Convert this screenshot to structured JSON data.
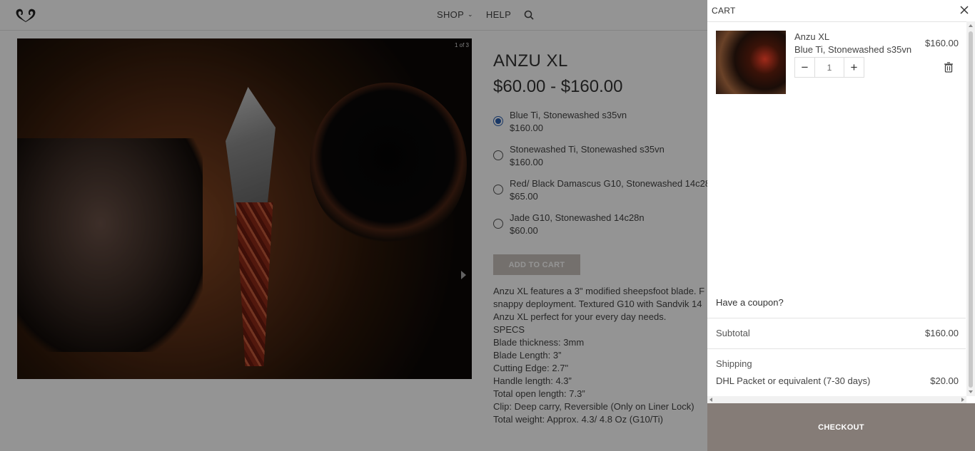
{
  "header": {
    "nav": [
      {
        "label": "SHOP",
        "has_dropdown": true
      },
      {
        "label": "HELP",
        "has_dropdown": false
      }
    ]
  },
  "gallery": {
    "counter": "1 of 3"
  },
  "product": {
    "title": "ANZU XL",
    "price_range": "$60.00 - $160.00",
    "variants": [
      {
        "name": "Blue Ti, Stonewashed s35vn",
        "price": "$160.00",
        "selected": true
      },
      {
        "name": "Stonewashed Ti, Stonewashed s35vn",
        "price": "$160.00",
        "selected": false
      },
      {
        "name": "Red/ Black Damascus G10, Stonewashed 14c28",
        "price": "$65.00",
        "selected": false
      },
      {
        "name": "Jade G10, Stonewashed 14c28n",
        "price": "$60.00",
        "selected": false
      }
    ],
    "add_to_cart_label": "ADD TO CART",
    "description_lines": [
      "Anzu XL features a 3\" modified sheepsfoot blade. F",
      "snappy deployment. Textured G10 with Sandvik 14",
      "Anzu XL perfect for your every day needs.",
      "SPECS",
      "Blade thickness: 3mm",
      "Blade Length: 3”",
      "Cutting Edge: 2.7\"",
      "Handle length: 4.3”",
      "Total open length: 7.3”",
      "Clip: Deep carry, Reversible (Only on Liner Lock)",
      "Total weight: Approx. 4.3/ 4.8 Oz (G10/Ti)"
    ]
  },
  "cart": {
    "title": "CART",
    "item": {
      "name": "Anzu XL",
      "variant": "Blue Ti, Stonewashed s35vn",
      "price": "$160.00",
      "quantity": "1"
    },
    "coupon_label": "Have a coupon?",
    "subtotal_label": "Subtotal",
    "subtotal_value": "$160.00",
    "shipping_label": "Shipping",
    "shipping_method": "DHL Packet or equivalent (7-30 days)",
    "shipping_price": "$20.00",
    "checkout_label": "CHECKOUT"
  },
  "colors": {
    "accent_radio": "#2a5fb0",
    "checkout_bg": "#857c77",
    "add_to_cart_bg": "#c9c2bc"
  }
}
